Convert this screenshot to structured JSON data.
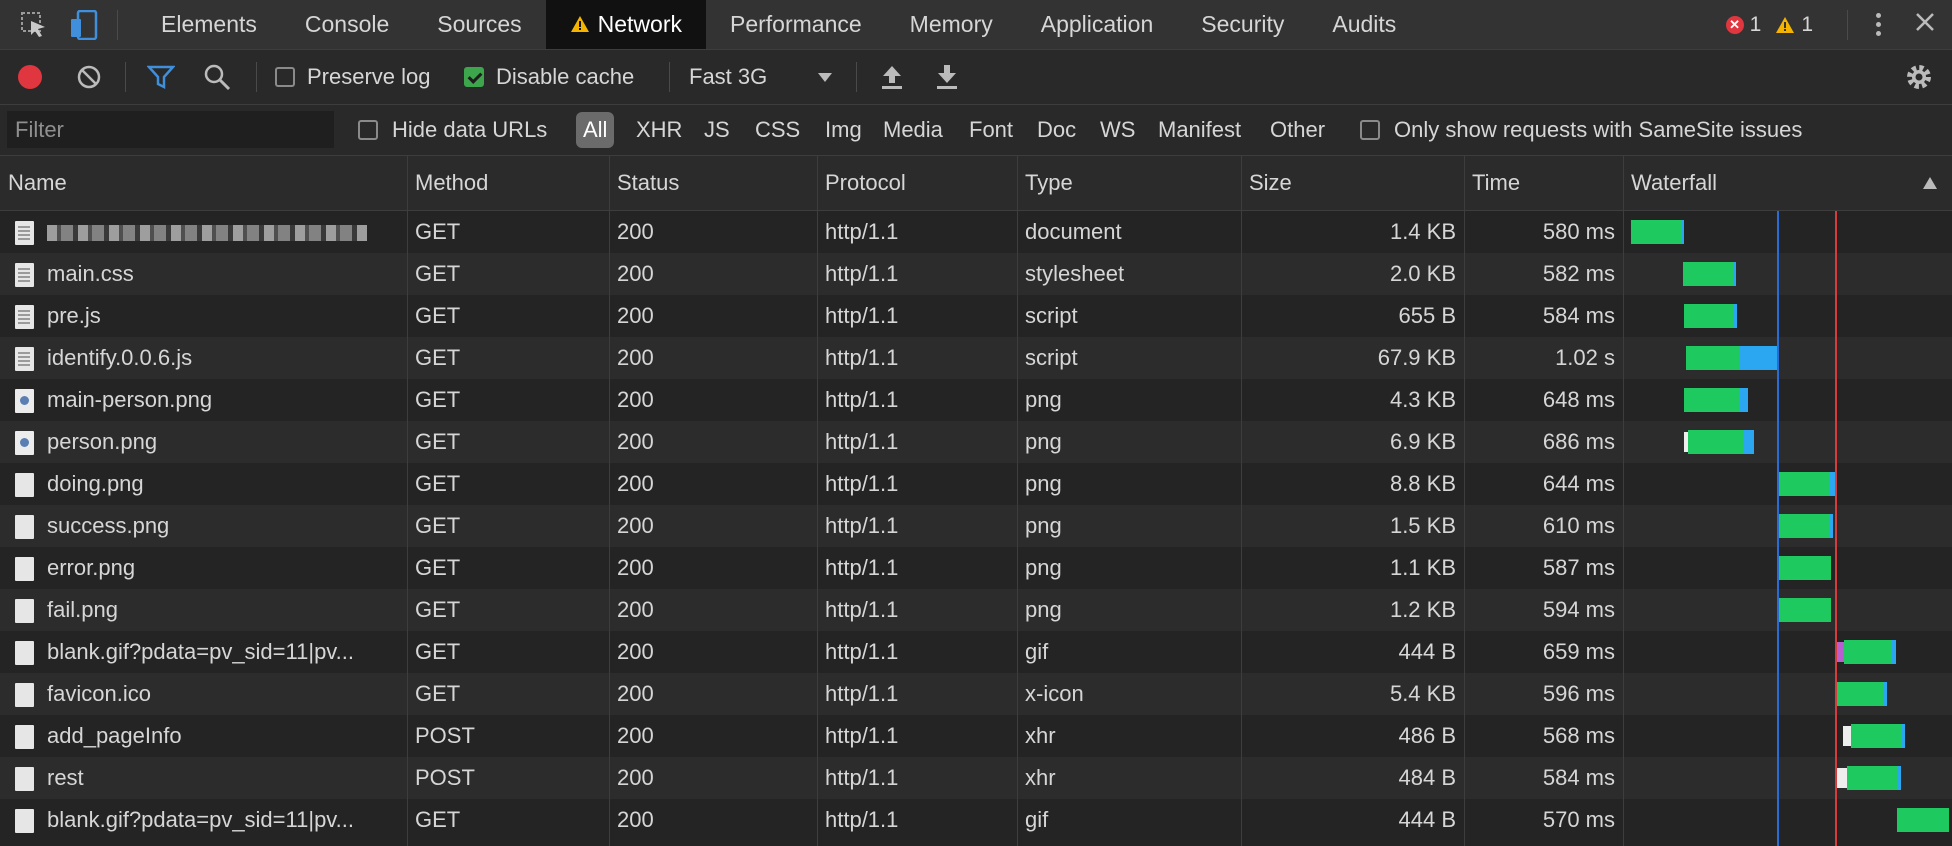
{
  "tabs": [
    "Elements",
    "Console",
    "Sources",
    "Network",
    "Performance",
    "Memory",
    "Application",
    "Security",
    "Audits"
  ],
  "active_tab": "Network",
  "errors_count": "1",
  "warnings_count": "1",
  "toolbar": {
    "preserve_log_label": "Preserve log",
    "preserve_log_checked": false,
    "disable_cache_label": "Disable cache",
    "disable_cache_checked": true,
    "throttling_value": "Fast 3G"
  },
  "filterbar": {
    "filter_placeholder": "Filter",
    "hide_data_urls_label": "Hide data URLs",
    "types": [
      "All",
      "XHR",
      "JS",
      "CSS",
      "Img",
      "Media",
      "Font",
      "Doc",
      "WS",
      "Manifest",
      "Other"
    ],
    "active_type": "All",
    "samesite_label": "Only show requests with SameSite issues"
  },
  "columns": [
    "Name",
    "Method",
    "Status",
    "Protocol",
    "Type",
    "Size",
    "Time",
    "Waterfall"
  ],
  "rows": [
    {
      "name": "",
      "blurred": true,
      "method": "GET",
      "status": "200",
      "protocol": "http/1.1",
      "type": "document",
      "size": "1.4 KB",
      "time": "580 ms",
      "icon": "document-icon"
    },
    {
      "name": "main.css",
      "method": "GET",
      "status": "200",
      "protocol": "http/1.1",
      "type": "stylesheet",
      "size": "2.0 KB",
      "time": "582 ms",
      "icon": "document-icon"
    },
    {
      "name": "pre.js",
      "method": "GET",
      "status": "200",
      "protocol": "http/1.1",
      "type": "script",
      "size": "655 B",
      "time": "584 ms",
      "icon": "document-icon"
    },
    {
      "name": "identify.0.0.6.js",
      "method": "GET",
      "status": "200",
      "protocol": "http/1.1",
      "type": "script",
      "size": "67.9 KB",
      "time": "1.02 s",
      "icon": "document-icon"
    },
    {
      "name": "main-person.png",
      "method": "GET",
      "status": "200",
      "protocol": "http/1.1",
      "type": "png",
      "size": "4.3 KB",
      "time": "648 ms",
      "icon": "image-icon"
    },
    {
      "name": "person.png",
      "method": "GET",
      "status": "200",
      "protocol": "http/1.1",
      "type": "png",
      "size": "6.9 KB",
      "time": "686 ms",
      "icon": "image-icon"
    },
    {
      "name": "doing.png",
      "method": "GET",
      "status": "200",
      "protocol": "http/1.1",
      "type": "png",
      "size": "8.8 KB",
      "time": "644 ms",
      "icon": "file-icon"
    },
    {
      "name": "success.png",
      "method": "GET",
      "status": "200",
      "protocol": "http/1.1",
      "type": "png",
      "size": "1.5 KB",
      "time": "610 ms",
      "icon": "file-icon"
    },
    {
      "name": "error.png",
      "method": "GET",
      "status": "200",
      "protocol": "http/1.1",
      "type": "png",
      "size": "1.1 KB",
      "time": "587 ms",
      "icon": "file-icon"
    },
    {
      "name": "fail.png",
      "method": "GET",
      "status": "200",
      "protocol": "http/1.1",
      "type": "png",
      "size": "1.2 KB",
      "time": "594 ms",
      "icon": "file-icon"
    },
    {
      "name": "blank.gif?pdata=pv_sid=11|pv...",
      "method": "GET",
      "status": "200",
      "protocol": "http/1.1",
      "type": "gif",
      "size": "444 B",
      "time": "659 ms",
      "icon": "file-icon"
    },
    {
      "name": "favicon.ico",
      "method": "GET",
      "status": "200",
      "protocol": "http/1.1",
      "type": "x-icon",
      "size": "5.4 KB",
      "time": "596 ms",
      "icon": "file-icon"
    },
    {
      "name": "add_pageInfo",
      "method": "POST",
      "status": "200",
      "protocol": "http/1.1",
      "type": "xhr",
      "size": "486 B",
      "time": "568 ms",
      "icon": "file-icon"
    },
    {
      "name": "rest",
      "method": "POST",
      "status": "200",
      "protocol": "http/1.1",
      "type": "xhr",
      "size": "484 B",
      "time": "584 ms",
      "icon": "file-icon"
    },
    {
      "name": "blank.gif?pdata=pv_sid=11|pv...",
      "method": "GET",
      "status": "200",
      "protocol": "http/1.1",
      "type": "gif",
      "size": "444 B",
      "time": "570 ms",
      "icon": "file-icon"
    }
  ],
  "colors": {
    "record_red": "#e0363f",
    "waiting_green": "#1ec95f",
    "download_blue": "#2aa7f0",
    "dom_content_loaded_line": "#2b6bd6",
    "load_line": "#d63c3c"
  }
}
